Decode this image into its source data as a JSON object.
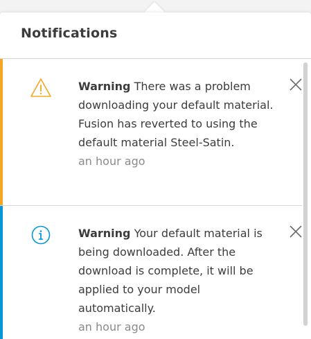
{
  "header": {
    "title": "Notifications"
  },
  "notifications": [
    {
      "severity": "warning",
      "icon": "warning-triangle-icon",
      "accent_color": "#f5a623",
      "label": "Warning",
      "message": " There was a problem downloading your default material. Fusion has reverted to using the default material Steel-Satin.",
      "time": "an hour ago"
    },
    {
      "severity": "info",
      "icon": "info-circle-icon",
      "accent_color": "#0696d7",
      "label": "Warning",
      "message": " Your default material is being downloaded. After the download is complete, it will be applied to your model automatically.",
      "time": "an hour ago"
    }
  ]
}
